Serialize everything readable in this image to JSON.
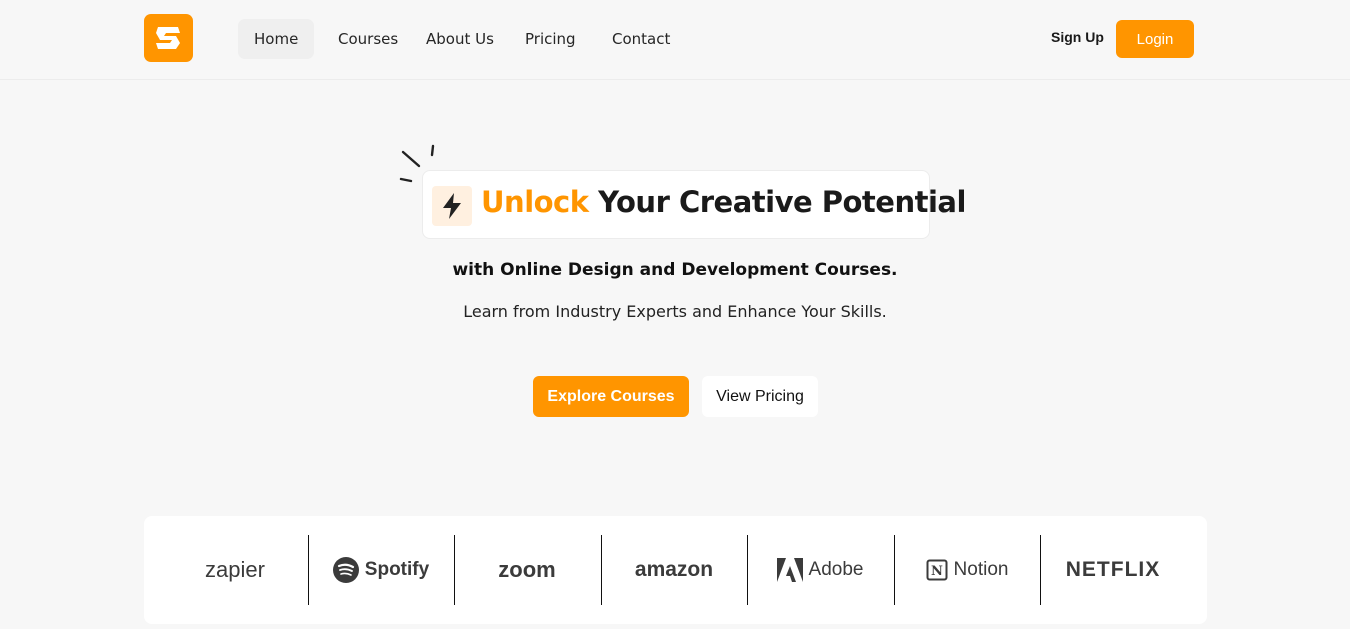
{
  "nav": {
    "items": [
      {
        "label": "Home",
        "active": true
      },
      {
        "label": "Courses"
      },
      {
        "label": "About Us"
      },
      {
        "label": "Pricing"
      },
      {
        "label": "Contact"
      }
    ],
    "signup_label": "Sign Up",
    "login_label": "Login"
  },
  "hero": {
    "headline_accent": "Unlock",
    "headline_rest": "Your Creative Potential",
    "subtitle": "with Online Design and Development Courses.",
    "tagline": "Learn from Industry Experts and Enhance Your Skills.",
    "explore_label": "Explore Courses",
    "pricing_label": "View Pricing"
  },
  "partners": [
    "zapier",
    "Spotify",
    "zoom",
    "amazon",
    "Adobe",
    "Notion",
    "NETFLIX"
  ],
  "colors": {
    "accent": "#ff9500",
    "background": "#f7f7f7",
    "accent_soft": "#fff0e0"
  },
  "icons": {
    "logo": "brand-logo-icon",
    "bolt": "lightning-bolt-icon",
    "spark": "spark-lines-icon"
  }
}
